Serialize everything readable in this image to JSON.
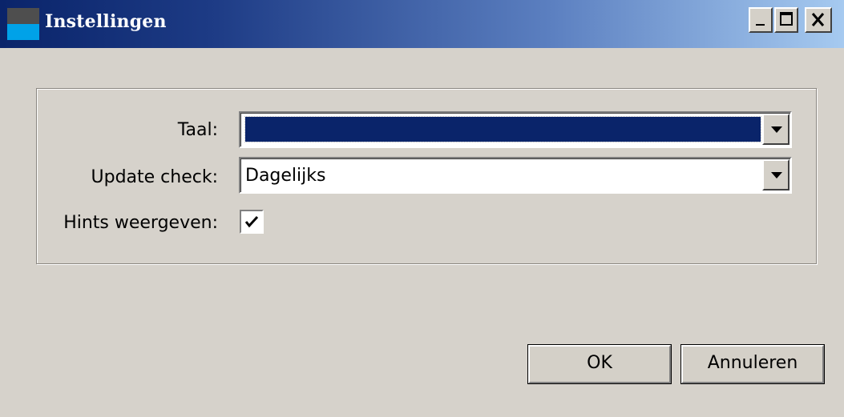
{
  "window": {
    "title": "Instellingen",
    "controls": [
      "minimize-icon",
      "maximize-icon",
      "close-icon"
    ]
  },
  "form": {
    "language": {
      "label": "Taal:",
      "value": ""
    },
    "update_check": {
      "label": "Update check:",
      "value": "Dagelijks"
    },
    "hints": {
      "label": "Hints weergeven:",
      "checked": true
    }
  },
  "buttons": {
    "ok": "OK",
    "cancel": "Annuleren"
  },
  "colors": {
    "titlebar_start": "#0a246a",
    "titlebar_end": "#a6caf0",
    "selection": "#0a246a",
    "face": "#d6d2cb"
  }
}
